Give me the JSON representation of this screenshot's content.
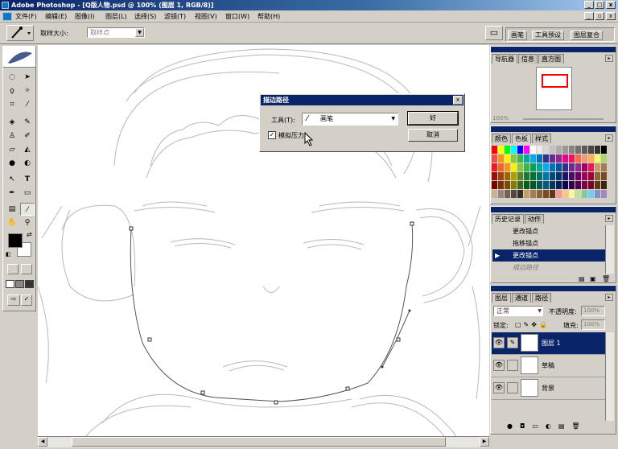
{
  "window": {
    "title": "Adobe Photoshop - [Q版人物.psd @ 100% (图层 1, RGB/8)]",
    "win_buttons": [
      "_",
      "□",
      "x"
    ],
    "doc_buttons": [
      "_",
      "▫",
      "x"
    ]
  },
  "menu": [
    "文件(F)",
    "编辑(E)",
    "图像(I)",
    "图层(L)",
    "选择(S)",
    "滤镜(T)",
    "视图(V)",
    "窗口(W)",
    "帮助(H)"
  ],
  "options": {
    "label": "取样大小:",
    "select_value": "取样点",
    "right_tabs": [
      "画笔",
      "工具预设",
      "图层复合"
    ]
  },
  "navigator": {
    "tabs": [
      "导航器",
      "信息",
      "直方图"
    ],
    "zoom": "100%"
  },
  "swatches": {
    "tabs": [
      "颜色",
      "色板",
      "样式"
    ],
    "colors": [
      [
        "#ff0000",
        "#ffff00",
        "#00ff00",
        "#00ffff",
        "#0000ff",
        "#ff00ff",
        "#ffffff",
        "#ebebeb",
        "#d6d6d6",
        "#c2c2c2",
        "#adadad",
        "#999999",
        "#858585",
        "#707070",
        "#5c5c5c",
        "#474747",
        "#333333",
        "#000000"
      ],
      [
        "#f04d4d",
        "#f7941d",
        "#fff200",
        "#8dc63f",
        "#39b54a",
        "#00a99d",
        "#00aeef",
        "#0072bc",
        "#2e3192",
        "#662d91",
        "#92278f",
        "#ec008c",
        "#ed145b",
        "#f26c4f",
        "#f69679",
        "#fbaf5d",
        "#fff568",
        "#acd373"
      ],
      [
        "#ed1c24",
        "#f26522",
        "#f7941d",
        "#fff200",
        "#8dc63f",
        "#39b54a",
        "#00a651",
        "#00a99d",
        "#00aeef",
        "#0072bc",
        "#0054a6",
        "#2e3192",
        "#662d91",
        "#92278f",
        "#9e005d",
        "#ed145b",
        "#c69c6d",
        "#a67c52"
      ],
      [
        "#9e0b0f",
        "#a0410d",
        "#a3620a",
        "#aba000",
        "#598527",
        "#1a7b30",
        "#007236",
        "#00746b",
        "#0076a3",
        "#004a80",
        "#003471",
        "#1b1464",
        "#440e62",
        "#630460",
        "#9e005d",
        "#9e0039",
        "#8c6239",
        "#754c24"
      ],
      [
        "#790000",
        "#7b2e00",
        "#7d4900",
        "#827b00",
        "#406618",
        "#005e20",
        "#005826",
        "#005952",
        "#005b7f",
        "#003663",
        "#002157",
        "#0d004c",
        "#32004b",
        "#4b0049",
        "#7b0046",
        "#7a0026",
        "#603913",
        "#3c2415"
      ],
      [
        "#c7b299",
        "#998675",
        "#736357",
        "#534741",
        "#37302a",
        "#c69c6d",
        "#a67c52",
        "#8c6239",
        "#754c24",
        "#603913",
        "#f5989d",
        "#fdc689",
        "#fff799",
        "#c4df9b",
        "#82ca9c",
        "#6dcff6",
        "#8393ca",
        "#a187be"
      ]
    ]
  },
  "history": {
    "tabs": [
      "历史记录",
      "动作"
    ],
    "items": [
      "更改锚点",
      "拖移锚点",
      "更改锚点",
      "描边路径"
    ],
    "selected_index": 2
  },
  "layers": {
    "tabs": [
      "图层",
      "通道",
      "路径"
    ],
    "blend_mode": "正常",
    "opacity_label": "不透明度:",
    "opacity_value": "100%",
    "lock_label": "锁定:",
    "fill_label": "填充:",
    "fill_value": "100%",
    "items": [
      {
        "name": "图层 1",
        "selected": true
      },
      {
        "name": "草稿",
        "selected": false
      },
      {
        "name": "背景",
        "selected": false
      }
    ]
  },
  "dialog": {
    "title": "描边路径",
    "tool_label": "工具(T):",
    "tool_value": "画笔",
    "checkbox_label": "模拟压力",
    "checkbox_checked": true,
    "ok_label": "好",
    "cancel_label": "取消"
  },
  "colors": {
    "selection": "#0a246a",
    "panel": "#d4d0c8"
  }
}
